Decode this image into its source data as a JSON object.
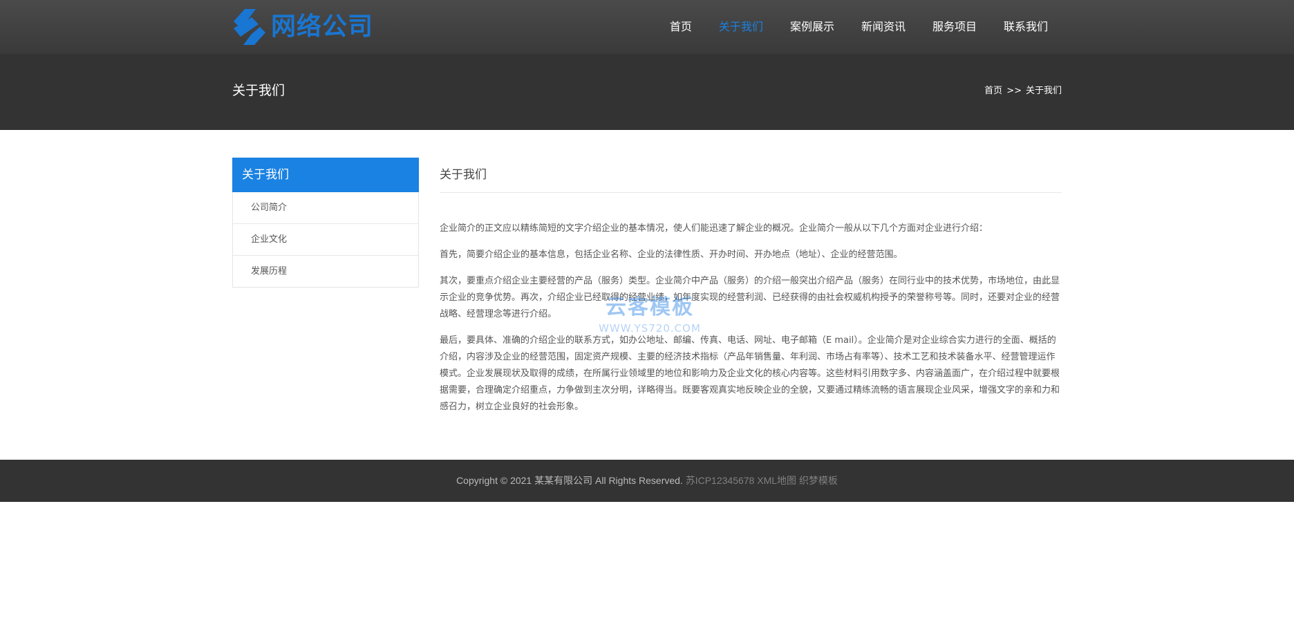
{
  "header": {
    "logo_text": "网络公司",
    "nav": [
      {
        "label": "首页",
        "active": false
      },
      {
        "label": "关于我们",
        "active": true
      },
      {
        "label": "案例展示",
        "active": false
      },
      {
        "label": "新闻资讯",
        "active": false
      },
      {
        "label": "服务项目",
        "active": false
      },
      {
        "label": "联系我们",
        "active": false
      }
    ]
  },
  "banner": {
    "title": "关于我们",
    "breadcrumb": {
      "home": "首页",
      "separator": ">>",
      "current": "关于我们"
    }
  },
  "sidebar": {
    "title": "关于我们",
    "items": [
      {
        "label": "公司简介"
      },
      {
        "label": "企业文化"
      },
      {
        "label": "发展历程"
      }
    ]
  },
  "main": {
    "title": "关于我们",
    "paragraphs": [
      "企业简介的正文应以精练简短的文字介绍企业的基本情况，使人们能迅速了解企业的概况。企业简介一般从以下几个方面对企业进行介绍：",
      "首先，简要介绍企业的基本信息，包括企业名称、企业的法律性质、开办时间、开办地点（地址）、企业的经营范围。",
      "其次，要重点介绍企业主要经营的产品（服务）类型。企业简介中产品（服务）的介绍一般突出介绍产品（服务）在同行业中的技术优势，市场地位，由此显示企业的竞争优势。再次，介绍企业已经取得的经营业绩，如年度实现的经营利润、已经获得的由社会权威机构授予的荣誉称号等。同时，还要对企业的经营战略、经营理念等进行介绍。",
      "最后，要具体、准确的介绍企业的联系方式，如办公地址、邮编、传真、电话、网址、电子邮箱（E mail）。企业简介是对企业综合实力进行的全面、概括的介绍，内容涉及企业的经营范围，固定资产规模、主要的经济技术指标（产品年销售量、年利润、市场占有率等）、技术工艺和技术装备水平、经营管理运作模式。企业发展现状及取得的成绩，在所属行业领域里的地位和影响力及企业文化的核心内容等。这些材料引用数字多、内容涵盖面广，在介绍过程中就要根据需要，合理确定介绍重点，力争做到主次分明，详略得当。既要客观真实地反映企业的全貌，又要通过精练流畅的语言展现企业风采，增强文字的亲和力和感召力，树立企业良好的社会形象。"
    ]
  },
  "watermark": {
    "line1": "云客模板",
    "line2": "WWW.YS720.COM"
  },
  "footer": {
    "copyright": "Copyright © 2021 某某有限公司 All Rights Reserved.",
    "icp": "苏ICP12345678",
    "xml_map": "XML地图",
    "template": "织梦模板"
  },
  "colors": {
    "accent": "#1a82e2",
    "header_bg": "#424242",
    "banner_bg": "#333333",
    "footer_bg": "#333333"
  }
}
